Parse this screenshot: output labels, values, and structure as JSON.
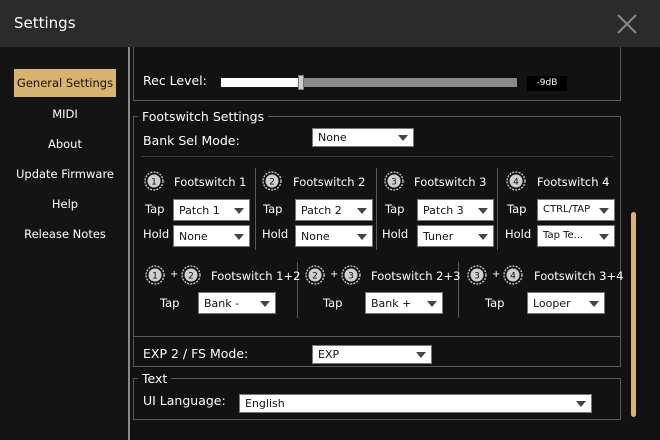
{
  "window": {
    "title": "Settings"
  },
  "sidebar": {
    "items": [
      {
        "label": "General Settings",
        "active": true
      },
      {
        "label": "MIDI"
      },
      {
        "label": "About"
      },
      {
        "label": "Update Firmware"
      },
      {
        "label": "Help"
      },
      {
        "label": "Release Notes"
      }
    ]
  },
  "rec_level": {
    "label": "Rec Level:",
    "value_text": "-9dB",
    "fraction": 0.27
  },
  "footswitch": {
    "section_title": "Footswitch Settings",
    "bank_sel_label": "Bank Sel Mode:",
    "bank_sel_value": "None",
    "tap_label": "Tap",
    "hold_label": "Hold",
    "plus": "+",
    "switches": [
      {
        "num": "1",
        "name": "Footswitch 1",
        "tap": "Patch 1",
        "hold": "None"
      },
      {
        "num": "2",
        "name": "Footswitch 2",
        "tap": "Patch 2",
        "hold": "None"
      },
      {
        "num": "3",
        "name": "Footswitch 3",
        "tap": "Patch 3",
        "hold": "Tuner"
      },
      {
        "num": "4",
        "name": "Footswitch 4",
        "tap": "CTRL/TAP",
        "hold": "Tap Te..."
      }
    ],
    "combos": [
      {
        "a": "1",
        "b": "2",
        "name": "Footswitch 1+2",
        "tap": "Bank -"
      },
      {
        "a": "2",
        "b": "3",
        "name": "Footswitch 2+3",
        "tap": "Bank +"
      },
      {
        "a": "3",
        "b": "4",
        "name": "Footswitch 3+4",
        "tap": "Looper"
      }
    ]
  },
  "exp": {
    "label": "EXP 2 / FS Mode:",
    "value": "EXP"
  },
  "text_section": {
    "title": "Text",
    "language_label": "UI Language:",
    "language_value": "English"
  },
  "colors": {
    "accent": "#d8b36e",
    "background": "#121212",
    "titlebar": "#2b2b2b"
  }
}
